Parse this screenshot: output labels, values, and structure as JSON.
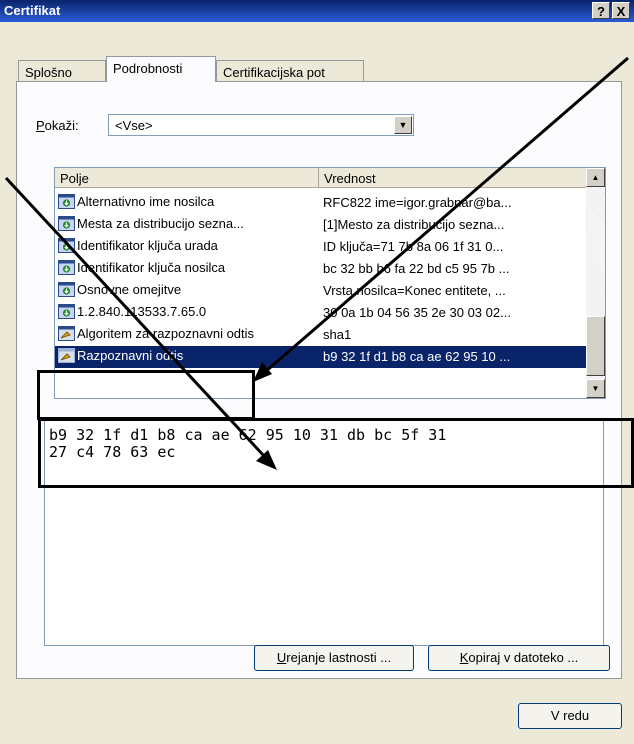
{
  "window": {
    "title": "Certifikat",
    "help_btn": "?",
    "close_btn": "X"
  },
  "tabs": [
    {
      "label": "Splošno"
    },
    {
      "label": "Podrobnosti"
    },
    {
      "label": "Certifikacijska pot"
    }
  ],
  "show": {
    "label_u": "P",
    "label_rest": "okaži:",
    "value": "<Vse>"
  },
  "list": {
    "col_field": "Polje",
    "col_value": "Vrednost",
    "rows": [
      {
        "field": "Alternativno ime nosilca",
        "value": "RFC822 ime=igor.grabnar@ba..."
      },
      {
        "field": "Mesta za distribucijo sezna...",
        "value": "[1]Mesto za distribucijo sezna..."
      },
      {
        "field": "Identifikator ključa urada",
        "value": "ID ključa=71 7b 8a 06 1f 31 0..."
      },
      {
        "field": "Identifikator ključa nosilca",
        "value": "bc 32 bb b6 fa 22 bd c5 95 7b ..."
      },
      {
        "field": "Osnovne omejitve",
        "value": "Vrsta nosilca=Konec entitete, ..."
      },
      {
        "field": "1.2.840.113533.7.65.0",
        "value": "30 0a 1b 04 56 35 2e 30 03 02..."
      },
      {
        "field": "Algoritem za razpoznavni odtis",
        "value": "sha1"
      },
      {
        "field": "Razpoznavni odtis",
        "value": "b9 32 1f d1 b8 ca ae 62 95 10 ..."
      }
    ]
  },
  "detail": {
    "line1": "b9 32 1f d1 b8 ca ae 62 95 10 31 db bc 5f 31",
    "line2": "27 c4 78 63 ec"
  },
  "buttons": {
    "edit_u": "U",
    "edit_rest": "rejanje lastnosti ...",
    "copy_u": "K",
    "copy_rest": "opiraj v datoteko ...",
    "ok": "V redu"
  },
  "colors": {
    "title_bar": "#0a246a",
    "selection": "#0a246a",
    "window_bg": "#ece9d8"
  }
}
